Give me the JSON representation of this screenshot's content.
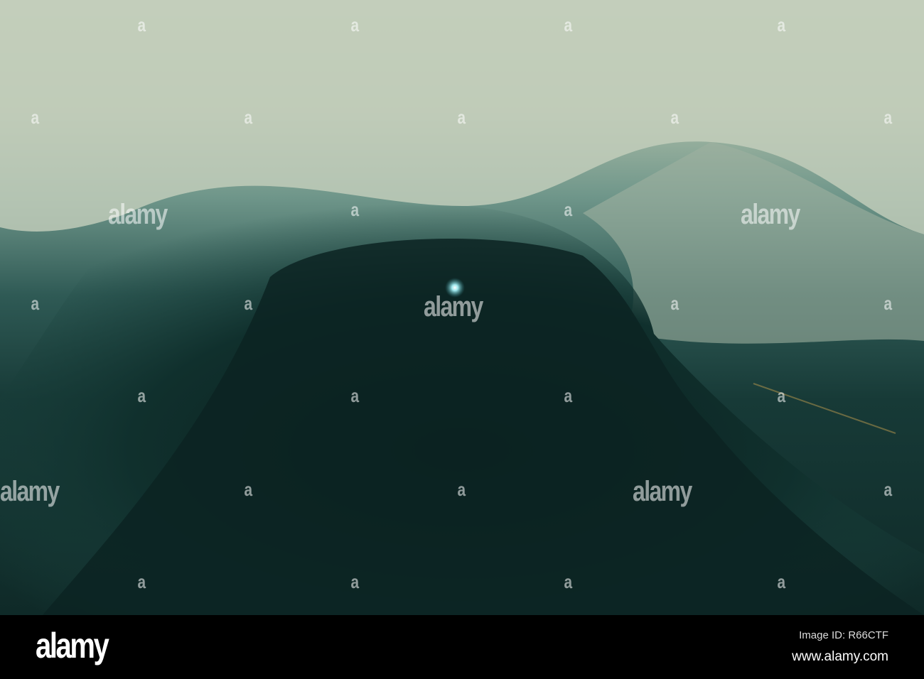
{
  "watermark": {
    "text": "alamy",
    "small": "a"
  },
  "footer": {
    "logo": "alamy",
    "image_id": "Image ID: R66CTF",
    "website": "www.alamy.com"
  }
}
